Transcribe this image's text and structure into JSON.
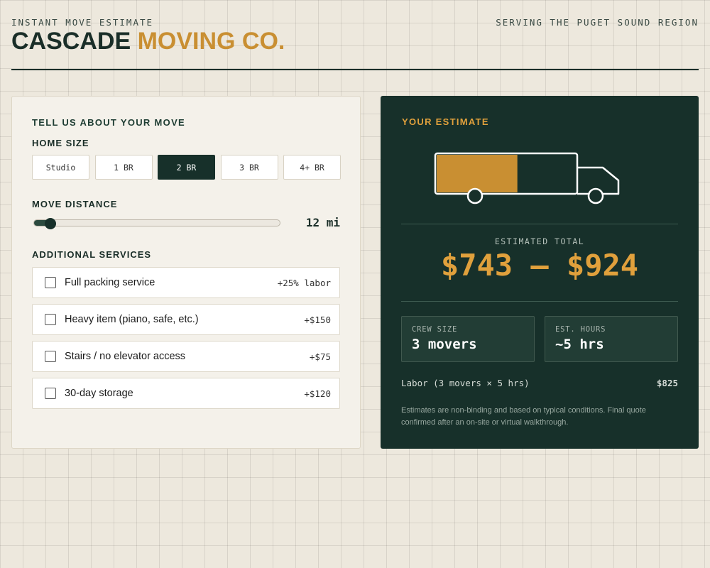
{
  "header": {
    "kicker": "INSTANT MOVE ESTIMATE",
    "brand_primary": "CASCADE",
    "brand_accent": "MOVING CO.",
    "region": "SERVING THE PUGET SOUND REGION"
  },
  "form": {
    "title": "TELL US ABOUT YOUR MOVE",
    "home_size": {
      "label": "HOME SIZE",
      "options": [
        "Studio",
        "1 BR",
        "2 BR",
        "3 BR",
        "4+ BR"
      ],
      "selected": "2 BR"
    },
    "distance": {
      "label": "MOVE DISTANCE",
      "value_text": "12 mi",
      "value": 12,
      "fraction": 0.07
    },
    "services": {
      "label": "ADDITIONAL SERVICES",
      "items": [
        {
          "name": "Full packing service",
          "price": "+25% labor",
          "checked": false
        },
        {
          "name": "Heavy item (piano, safe, etc.)",
          "price": "+$150",
          "checked": false
        },
        {
          "name": "Stairs / no elevator access",
          "price": "+$75",
          "checked": false
        },
        {
          "name": "30-day storage",
          "price": "+$120",
          "checked": false
        }
      ]
    }
  },
  "estimate": {
    "title": "YOUR ESTIMATE",
    "truck_fill_fraction": 0.58,
    "total_label": "ESTIMATED TOTAL",
    "total_value": "$743 – $924",
    "crew": {
      "label": "CREW SIZE",
      "value": "3 movers"
    },
    "hours": {
      "label": "EST. HOURS",
      "value": "~5 hrs"
    },
    "labor_line": "Labor (3 movers × 5 hrs)",
    "labor_amount": "$825",
    "disclaimer": "Estimates are non-binding and based on typical conditions. Final quote confirmed after an on-site or virtual walkthrough."
  },
  "colors": {
    "background": "#ede8dd",
    "dark_green": "#17302a",
    "accent_gold": "#c98f32",
    "estimate_gold": "#e0a03c"
  }
}
